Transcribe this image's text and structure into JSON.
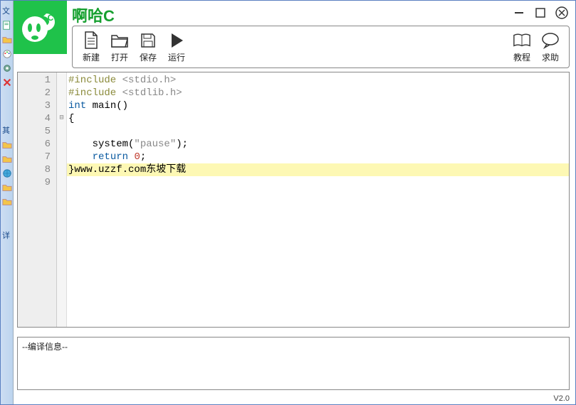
{
  "sidebar": {
    "labels": [
      "文",
      "其",
      "详"
    ]
  },
  "app": {
    "title": "啊哈C",
    "version": "V2.0"
  },
  "toolbar": {
    "new_label": "新建",
    "open_label": "打开",
    "save_label": "保存",
    "run_label": "运行",
    "tutorial_label": "教程",
    "help_label": "求助"
  },
  "window": {
    "minimize_glyph": "—",
    "maximize_glyph": "▢",
    "close_glyph": "✕"
  },
  "editor": {
    "line_count": 9,
    "fold_line": 4,
    "highlight_line": 8,
    "lines": [
      {
        "n": 1,
        "tokens": [
          {
            "t": "#include ",
            "c": "pp"
          },
          {
            "t": "<stdio.h>",
            "c": "str"
          }
        ]
      },
      {
        "n": 2,
        "tokens": [
          {
            "t": "#include ",
            "c": "pp"
          },
          {
            "t": "<stdlib.h>",
            "c": "str"
          }
        ]
      },
      {
        "n": 3,
        "tokens": [
          {
            "t": "int",
            "c": "kw"
          },
          {
            "t": " main()",
            "c": "fn"
          }
        ]
      },
      {
        "n": 4,
        "tokens": [
          {
            "t": "{",
            "c": "sym"
          }
        ]
      },
      {
        "n": 5,
        "tokens": []
      },
      {
        "n": 6,
        "tokens": [
          {
            "t": "    system(",
            "c": "fn"
          },
          {
            "t": "\"pause\"",
            "c": "str"
          },
          {
            "t": ");",
            "c": "sym"
          }
        ]
      },
      {
        "n": 7,
        "tokens": [
          {
            "t": "    ",
            "c": "txt"
          },
          {
            "t": "return",
            "c": "kw"
          },
          {
            "t": " ",
            "c": "txt"
          },
          {
            "t": "0",
            "c": "num"
          },
          {
            "t": ";",
            "c": "sym"
          }
        ]
      },
      {
        "n": 8,
        "tokens": [
          {
            "t": "}",
            "c": "sym"
          },
          {
            "t": "www.uzzf.com东坡下载",
            "c": "url"
          }
        ]
      },
      {
        "n": 9,
        "tokens": []
      }
    ]
  },
  "compile": {
    "label": "--编译信息--"
  }
}
